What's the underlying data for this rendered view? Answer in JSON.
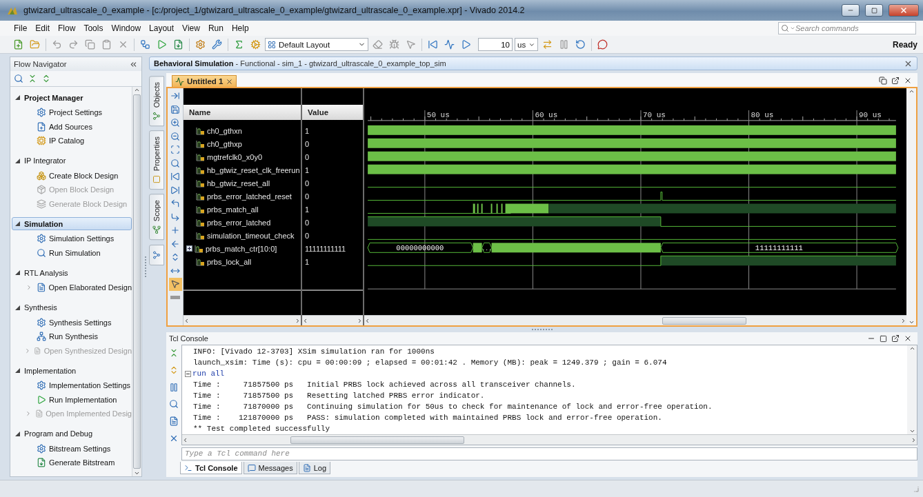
{
  "window": {
    "title": "gtwizard_ultrascale_0_example - [c:/project_1/gtwizard_ultrascale_0_example/gtwizard_ultrascale_0_example.xpr] - Vivado 2014.2"
  },
  "menu": [
    "File",
    "Edit",
    "Flow",
    "Tools",
    "Window",
    "Layout",
    "View",
    "Run",
    "Help"
  ],
  "search": {
    "placeholder": "Search commands"
  },
  "toolbar": {
    "layout": "Default Layout",
    "run_time": "10",
    "run_unit": "us",
    "status": "Ready"
  },
  "flow_navigator": {
    "title": "Flow Navigator",
    "sections": [
      {
        "title": "Project Manager",
        "expanded": true,
        "selected": false,
        "bold": true,
        "items": [
          {
            "label": "Project Settings",
            "disabled": false,
            "has_children": false
          },
          {
            "label": "Add Sources",
            "disabled": false,
            "has_children": false
          },
          {
            "label": "IP Catalog",
            "disabled": false,
            "has_children": false
          }
        ]
      },
      {
        "title": "IP Integrator",
        "expanded": true,
        "selected": false,
        "bold": false,
        "items": [
          {
            "label": "Create Block Design",
            "disabled": false,
            "has_children": false
          },
          {
            "label": "Open Block Design",
            "disabled": true,
            "has_children": false
          },
          {
            "label": "Generate Block Design",
            "disabled": true,
            "has_children": false
          }
        ]
      },
      {
        "title": "Simulation",
        "expanded": true,
        "selected": true,
        "bold": true,
        "items": [
          {
            "label": "Simulation Settings",
            "disabled": false,
            "has_children": false
          },
          {
            "label": "Run Simulation",
            "disabled": false,
            "has_children": false
          }
        ]
      },
      {
        "title": "RTL Analysis",
        "expanded": true,
        "selected": false,
        "bold": false,
        "items": [
          {
            "label": "Open Elaborated Design",
            "disabled": false,
            "has_children": true
          }
        ]
      },
      {
        "title": "Synthesis",
        "expanded": true,
        "selected": false,
        "bold": false,
        "items": [
          {
            "label": "Synthesis Settings",
            "disabled": false,
            "has_children": false
          },
          {
            "label": "Run Synthesis",
            "disabled": false,
            "has_children": false
          },
          {
            "label": "Open Synthesized Design",
            "disabled": true,
            "has_children": true
          }
        ]
      },
      {
        "title": "Implementation",
        "expanded": true,
        "selected": false,
        "bold": false,
        "items": [
          {
            "label": "Implementation Settings",
            "disabled": false,
            "has_children": false
          },
          {
            "label": "Run Implementation",
            "disabled": false,
            "has_children": false
          },
          {
            "label": "Open Implemented Desig",
            "disabled": true,
            "has_children": true
          }
        ]
      },
      {
        "title": "Program and Debug",
        "expanded": true,
        "selected": false,
        "bold": false,
        "items": [
          {
            "label": "Bitstream Settings",
            "disabled": false,
            "has_children": false
          },
          {
            "label": "Generate Bitstream",
            "disabled": false,
            "has_children": false
          }
        ]
      }
    ]
  },
  "side_tabs": [
    {
      "label": "Objects"
    },
    {
      "label": "Properties"
    },
    {
      "label": "Scope"
    }
  ],
  "sim_header": {
    "text": "**Behavioral Simulation** - Functional - sim_1 - gtwizard_ultrascale_0_example_top_sim"
  },
  "wave_window": {
    "tabs": [
      {
        "label": "Untitled 1",
        "selected": true
      }
    ],
    "columns": [
      "Name",
      "Value"
    ],
    "ruler": [
      "50 us",
      "60 us",
      "70 us",
      "80 us",
      "90 us"
    ],
    "signals": [
      {
        "name": "ch0_gthxn",
        "value": "1",
        "kind": "clock"
      },
      {
        "name": "ch0_gthxp",
        "value": "0",
        "kind": "clock"
      },
      {
        "name": "mgtrefclk0_x0y0",
        "value": "0",
        "kind": "clock"
      },
      {
        "name": "hb_gtwiz_reset_clk_freerun",
        "value": "1",
        "kind": "clock"
      },
      {
        "name": "hb_gtwiz_reset_all",
        "value": "0",
        "kind": "low"
      },
      {
        "name": "prbs_error_latched_reset",
        "value": "0",
        "kind": "pulse"
      },
      {
        "name": "prbs_match_all",
        "value": "1",
        "kind": "glitch"
      },
      {
        "name": "prbs_error_latched",
        "value": "0",
        "kind": "falling"
      },
      {
        "name": "simulation_timeout_check",
        "value": "0",
        "kind": "low"
      },
      {
        "name": "prbs_match_ctr[10:0]",
        "value": "11111111111",
        "kind": "bus",
        "expanded": false,
        "bus_labels": [
          "00000000000",
          "...",
          "11111111111"
        ]
      },
      {
        "name": "prbs_lock_all",
        "value": "1",
        "kind": "rising"
      }
    ]
  },
  "tcl_console": {
    "title": "Tcl Console",
    "lines": [
      {
        "text": "INFO: [Vivado 12-3703] XSim simulation ran for 1000ns",
        "kind": "output"
      },
      {
        "text": "launch_xsim: Time (s): cpu = 00:00:09 ; elapsed = 00:01:42 . Memory (MB): peak = 1249.379 ; gain = 6.074",
        "kind": "output"
      },
      {
        "text": "run all",
        "kind": "command"
      },
      {
        "text": "Time :     71857500 ps   Initial PRBS lock achieved across all transceiver channels.",
        "kind": "output"
      },
      {
        "text": "Time :     71857500 ps   Resetting latched PRBS error indicator.",
        "kind": "output"
      },
      {
        "text": "Time :     71870000 ps   Continuing simulation for 50us to check for maintenance of lock and error-free operation.",
        "kind": "output"
      },
      {
        "text": "Time :    121870000 ps   PASS: simulation completed with maintained PRBS lock and error-free operation.",
        "kind": "output"
      },
      {
        "text": "** Test completed successfully",
        "kind": "output"
      }
    ],
    "input": {
      "placeholder": "Type a Tcl command here"
    },
    "tabs": [
      {
        "label": "Tcl Console",
        "selected": true
      },
      {
        "label": "Messages",
        "selected": false
      },
      {
        "label": "Log",
        "selected": false
      }
    ]
  }
}
